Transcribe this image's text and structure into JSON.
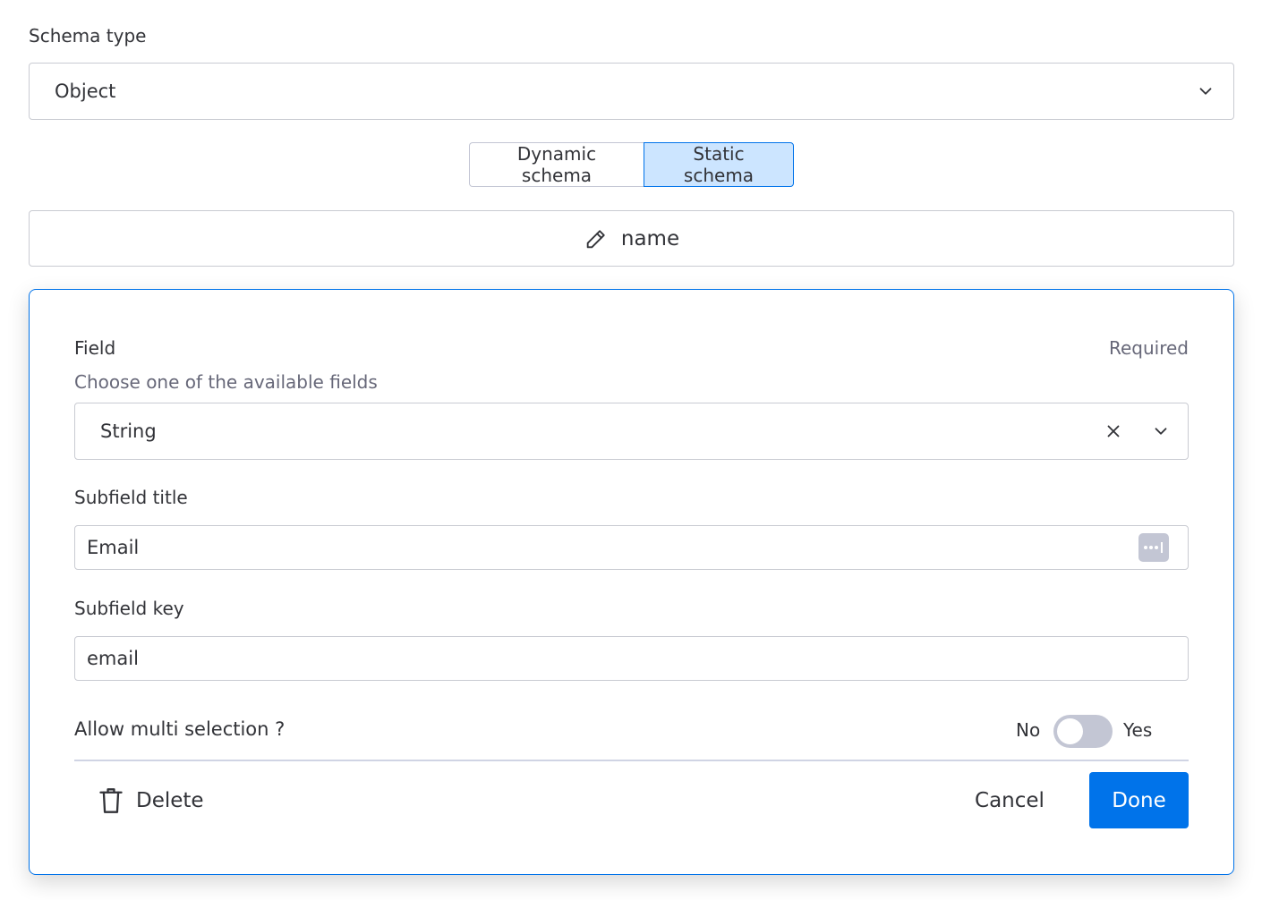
{
  "schema_type": {
    "label": "Schema type",
    "selected": "Object",
    "icon": "chevron-down-icon"
  },
  "schema_mode": {
    "options": [
      "Dynamic schema",
      "Static schema"
    ],
    "selected": "Static schema"
  },
  "subfield_header": {
    "label": "name",
    "icon": "pencil-icon"
  },
  "editor": {
    "field": {
      "label": "Field",
      "required": "Required",
      "help": "Choose one of the available fields",
      "selected": "String",
      "clear_icon": "close-icon",
      "dropdown_icon": "chevron-down-icon"
    },
    "subfield_title": {
      "label": "Subfield title",
      "value": "Email",
      "icon": "ellipsis-icon"
    },
    "subfield_key": {
      "label": "Subfield key",
      "value": "email"
    },
    "multi_selection": {
      "label": "Allow multi selection ?",
      "off_label": "No",
      "on_label": "Yes",
      "enabled": false
    },
    "actions": {
      "delete": "Delete",
      "delete_icon": "trash-icon",
      "cancel": "Cancel",
      "done": "Done"
    }
  },
  "colors": {
    "primary": "#0073ea",
    "selected_bg": "#cce5ff",
    "toggle_off": "#c3c6d4",
    "text": "#323338",
    "muted_text": "#676879"
  }
}
